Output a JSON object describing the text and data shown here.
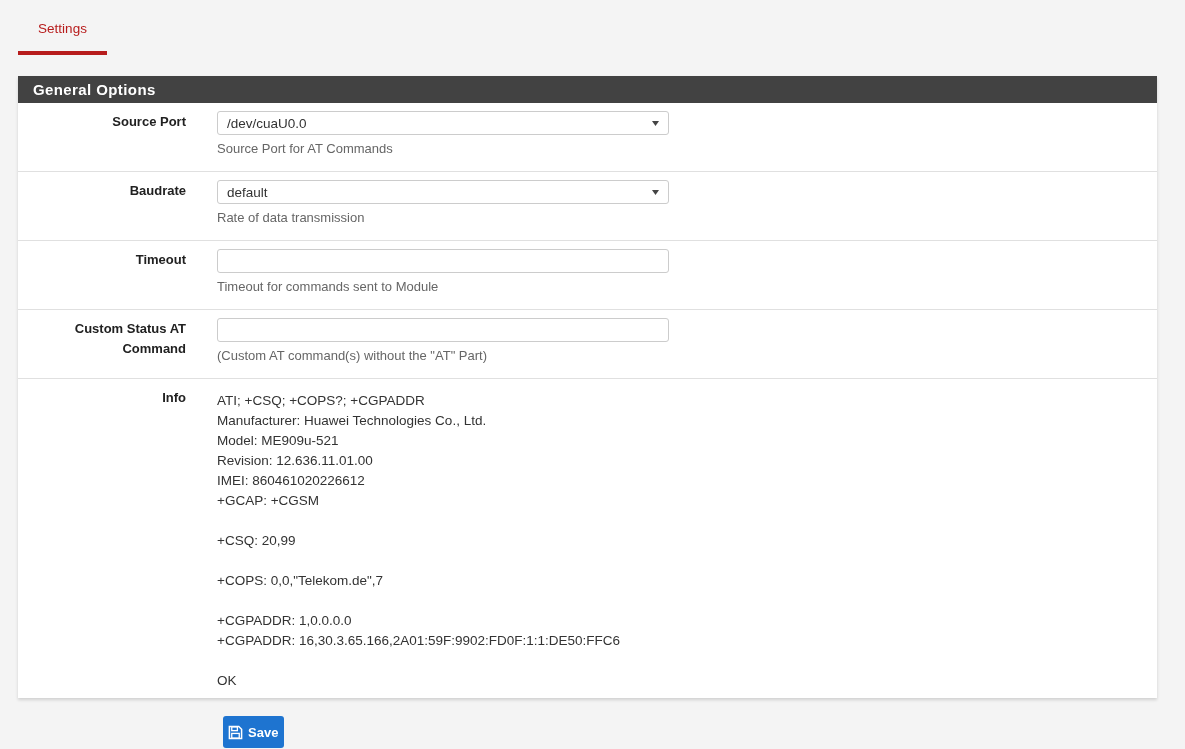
{
  "tabs": [
    {
      "label": "Settings",
      "selected": true
    }
  ],
  "panel": {
    "title": "General Options",
    "rows": [
      {
        "kind": "select",
        "label": "Source Port",
        "value": "/dev/cuaU0.0",
        "help": "Source Port for AT Commands"
      },
      {
        "kind": "select",
        "label": "Baudrate",
        "value": "default",
        "help": "Rate of data transmission"
      },
      {
        "kind": "input",
        "label": "Timeout",
        "help": "Timeout for commands sent to Module"
      },
      {
        "kind": "input",
        "label": "Custom Status AT Command",
        "help": "(Custom AT command(s) without the \"AT\" Part)"
      },
      {
        "kind": "info",
        "label": "Info",
        "blocks": [
          [
            "ATI; +CSQ; +COPS?; +CGPADDR",
            "Manufacturer: Huawei Technologies Co., Ltd.",
            "Model: ME909u-521",
            "Revision: 12.636.11.01.00",
            "IMEI: 860461020226612",
            "+GCAP: +CGSM"
          ],
          [
            "+CSQ: 20,99"
          ],
          [
            "+COPS: 0,0,\"Telekom.de\",7"
          ],
          [
            "+CGPADDR: 1,0.0.0.0",
            "+CGPADDR: 16,30.3.65.166,2A01:59F:9902:FD0F:1:1:DE50:FFC6"
          ],
          [
            "OK"
          ]
        ]
      }
    ]
  },
  "save_button": {
    "label": "Save"
  }
}
